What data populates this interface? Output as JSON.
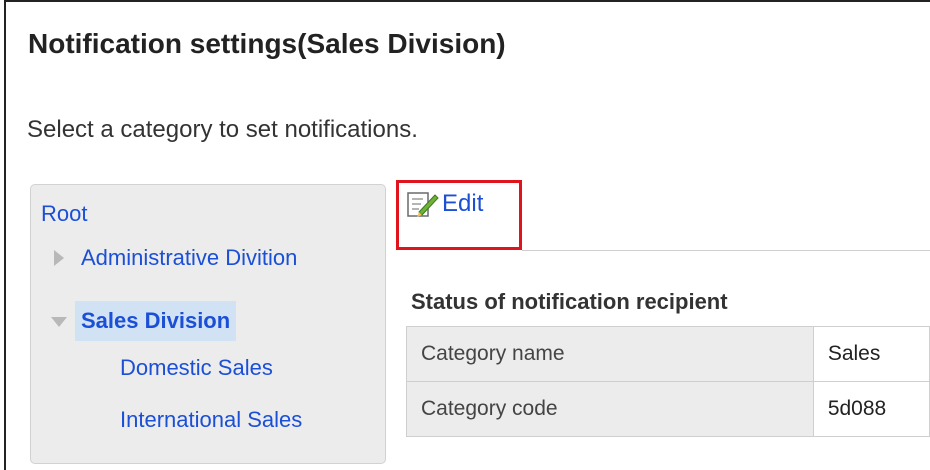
{
  "page": {
    "title": "Notification settings(Sales Division)",
    "instruction": "Select a category to set notifications."
  },
  "tree": {
    "root": "Root",
    "nodes": [
      {
        "label": "Administrative Divition",
        "expanded": false
      },
      {
        "label": "Sales Division",
        "expanded": true,
        "selected": true,
        "children": [
          "Domestic Sales",
          "International Sales"
        ]
      }
    ]
  },
  "toolbar": {
    "edit_label": "Edit",
    "edit_icon": "edit-icon"
  },
  "status": {
    "section_title": "Status of notification recipient",
    "rows": [
      {
        "label": "Category name",
        "value": "Sales"
      },
      {
        "label": "Category code",
        "value": "5d088"
      }
    ]
  },
  "colors": {
    "link": "#1a4fd6",
    "highlight_box": "#e0141c",
    "selected_bg": "#d2e2f5",
    "panel_bg": "#ececec"
  }
}
